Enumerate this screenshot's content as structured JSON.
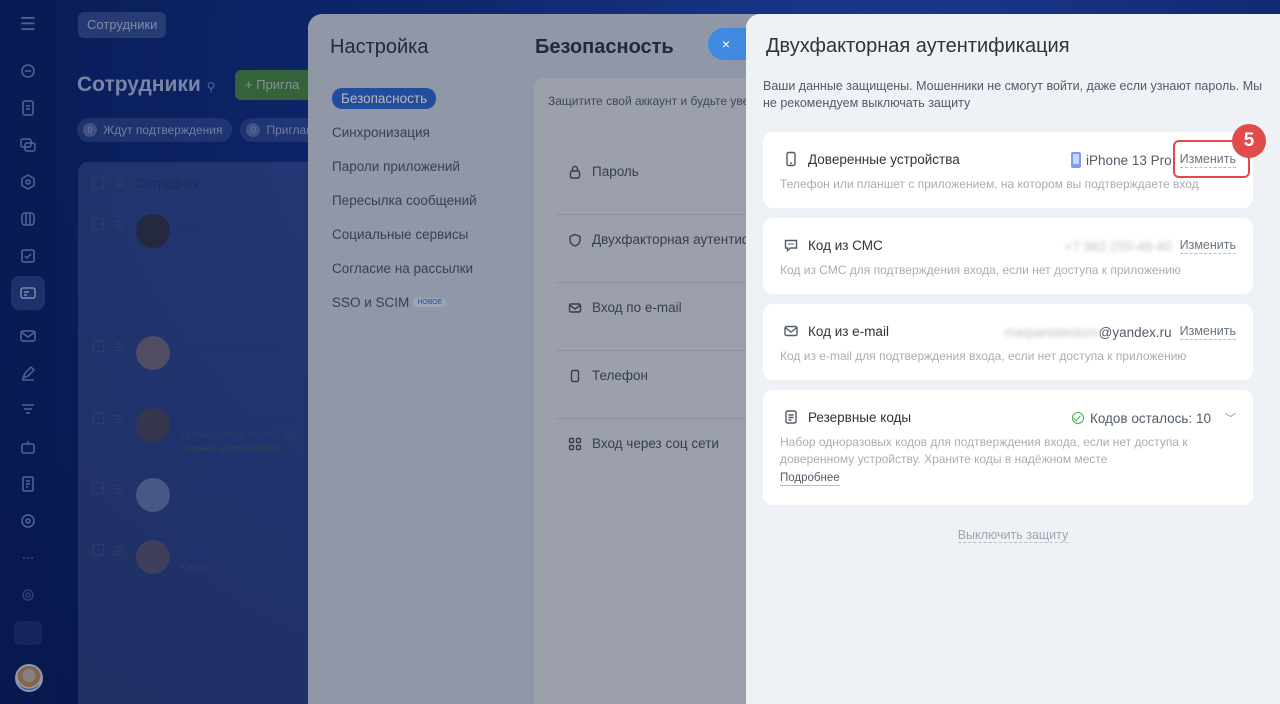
{
  "employees": {
    "breadcrumb": "Сотрудники",
    "title": "Сотрудники",
    "invite_label": "Пригла",
    "filters": [
      {
        "count": "0",
        "label": "Ждут подтверждения"
      },
      {
        "count": "0",
        "label": "Приглаш"
      }
    ],
    "column_header": "Сотрудник",
    "rows": [
      {
        "name": "Николай Король",
        "role": "",
        "badge": ""
      },
      {
        "name": "Елизавета Курган",
        "role": "",
        "badge": ""
      },
      {
        "name": "Наталья Мамаева",
        "role": "Руководитель отдела мар",
        "badge": "Главный администратор"
      },
      {
        "name": "Милена Ивлева",
        "role": "",
        "badge": ""
      },
      {
        "name": "Марьяна Колоскова",
        "role": "Юрист",
        "badge": ""
      }
    ]
  },
  "settings": {
    "title": "Настройка",
    "nav": [
      {
        "label": "Безопасность",
        "active": true
      },
      {
        "label": "Синхронизация"
      },
      {
        "label": "Пароли приложений"
      },
      {
        "label": "Пересылка сообщений"
      },
      {
        "label": "Социальные сервисы"
      },
      {
        "label": "Согласие на рассылки"
      },
      {
        "label": "SSO и SCIM",
        "badge": "НОВОЕ"
      }
    ],
    "section_title": "Безопасность",
    "intro": "Защитите свой аккаунт и будьте уве",
    "items": [
      {
        "label": "Пароль",
        "icon": "lock-icon"
      },
      {
        "label": "Двухфакторная аутентиф",
        "icon": "shield-icon"
      },
      {
        "label": "Вход по e-mail",
        "icon": "mail-icon"
      },
      {
        "label": "Телефон",
        "icon": "phone-icon"
      },
      {
        "label": "Вход через соц сети",
        "icon": "grid-icon"
      }
    ],
    "close_icon": "×"
  },
  "tfa": {
    "title": "Двухфакторная аутентификация",
    "description": "Ваши данные защищены. Мошенники не смогут войти, даже если узнают пароль. Мы не рекомендуем выключать защиту",
    "cards": {
      "devices": {
        "title": "Доверенные устройства",
        "value": "iPhone 13 Pro",
        "edit": "Изменить",
        "desc": "Телефон или планшет с приложением, на котором вы подтверждаете вход"
      },
      "sms": {
        "title": "Код из СМС",
        "value": "+7 962 250-48-40",
        "edit": "Изменить",
        "desc": "Код из СМС для подтверждения входа, если нет доступа к приложению"
      },
      "email": {
        "title": "Код из e-mail",
        "value_hidden": "marpantaledoro",
        "value_domain": "@yandex.ru",
        "edit": "Изменить",
        "desc": "Код из e-mail для подтверждения входа, если нет доступа к приложению"
      },
      "backup": {
        "title": "Резервные коды",
        "status": "Кодов осталось: 10",
        "desc": "Набор одноразовых кодов для подтверждения входа, если нет доступа к доверенному устройству. Храните коды в надёжном месте",
        "more": "Подробнее"
      }
    },
    "disable": "Выключить защиту"
  },
  "annotation": {
    "step": "5"
  },
  "colors": {
    "accent": "#2f6bd8",
    "highlight": "#e24b4b",
    "success": "#3fb54d"
  }
}
